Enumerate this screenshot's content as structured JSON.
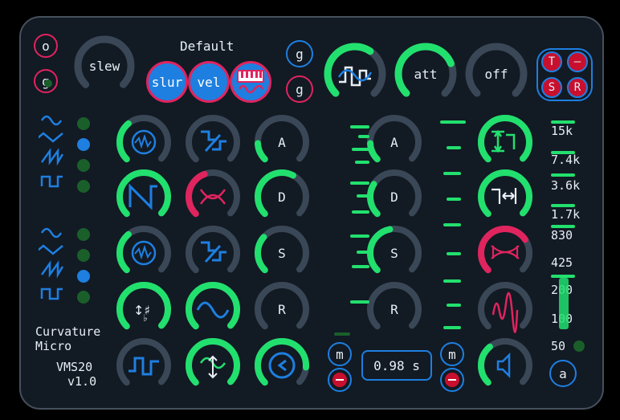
{
  "module": {
    "name_line1": "Curvature",
    "name_line2": "Micro",
    "model": "VMS20",
    "version": "v1.0"
  },
  "top": {
    "preset_label": "Default",
    "slew_label": "slew",
    "att_label": "att",
    "off_label": "off",
    "btn_o": "o",
    "btn_g": "g",
    "btn_g2": "g",
    "btn_g3": "g",
    "mode_slur": "slur",
    "mode_vel": "vel",
    "trs": [
      "T",
      "–",
      "S",
      "R"
    ]
  },
  "left_env": {
    "labels": [
      "A",
      "D",
      "S",
      "R"
    ]
  },
  "right_env": {
    "labels": [
      "A",
      "D",
      "S",
      "R"
    ]
  },
  "bottom": {
    "m1": "m",
    "m2": "m",
    "time_display": "0.98 s",
    "btn_a": "a"
  },
  "freq_scale": [
    "15k",
    "7.4k",
    "3.6k",
    "1.7k",
    "830",
    "425",
    "200",
    "100",
    "50"
  ],
  "colors": {
    "panel": "#121a24",
    "accent_green": "#22e06e",
    "accent_blue": "#1e7fe0",
    "accent_pink": "#e0245e",
    "knob_track": "#3a4756"
  }
}
